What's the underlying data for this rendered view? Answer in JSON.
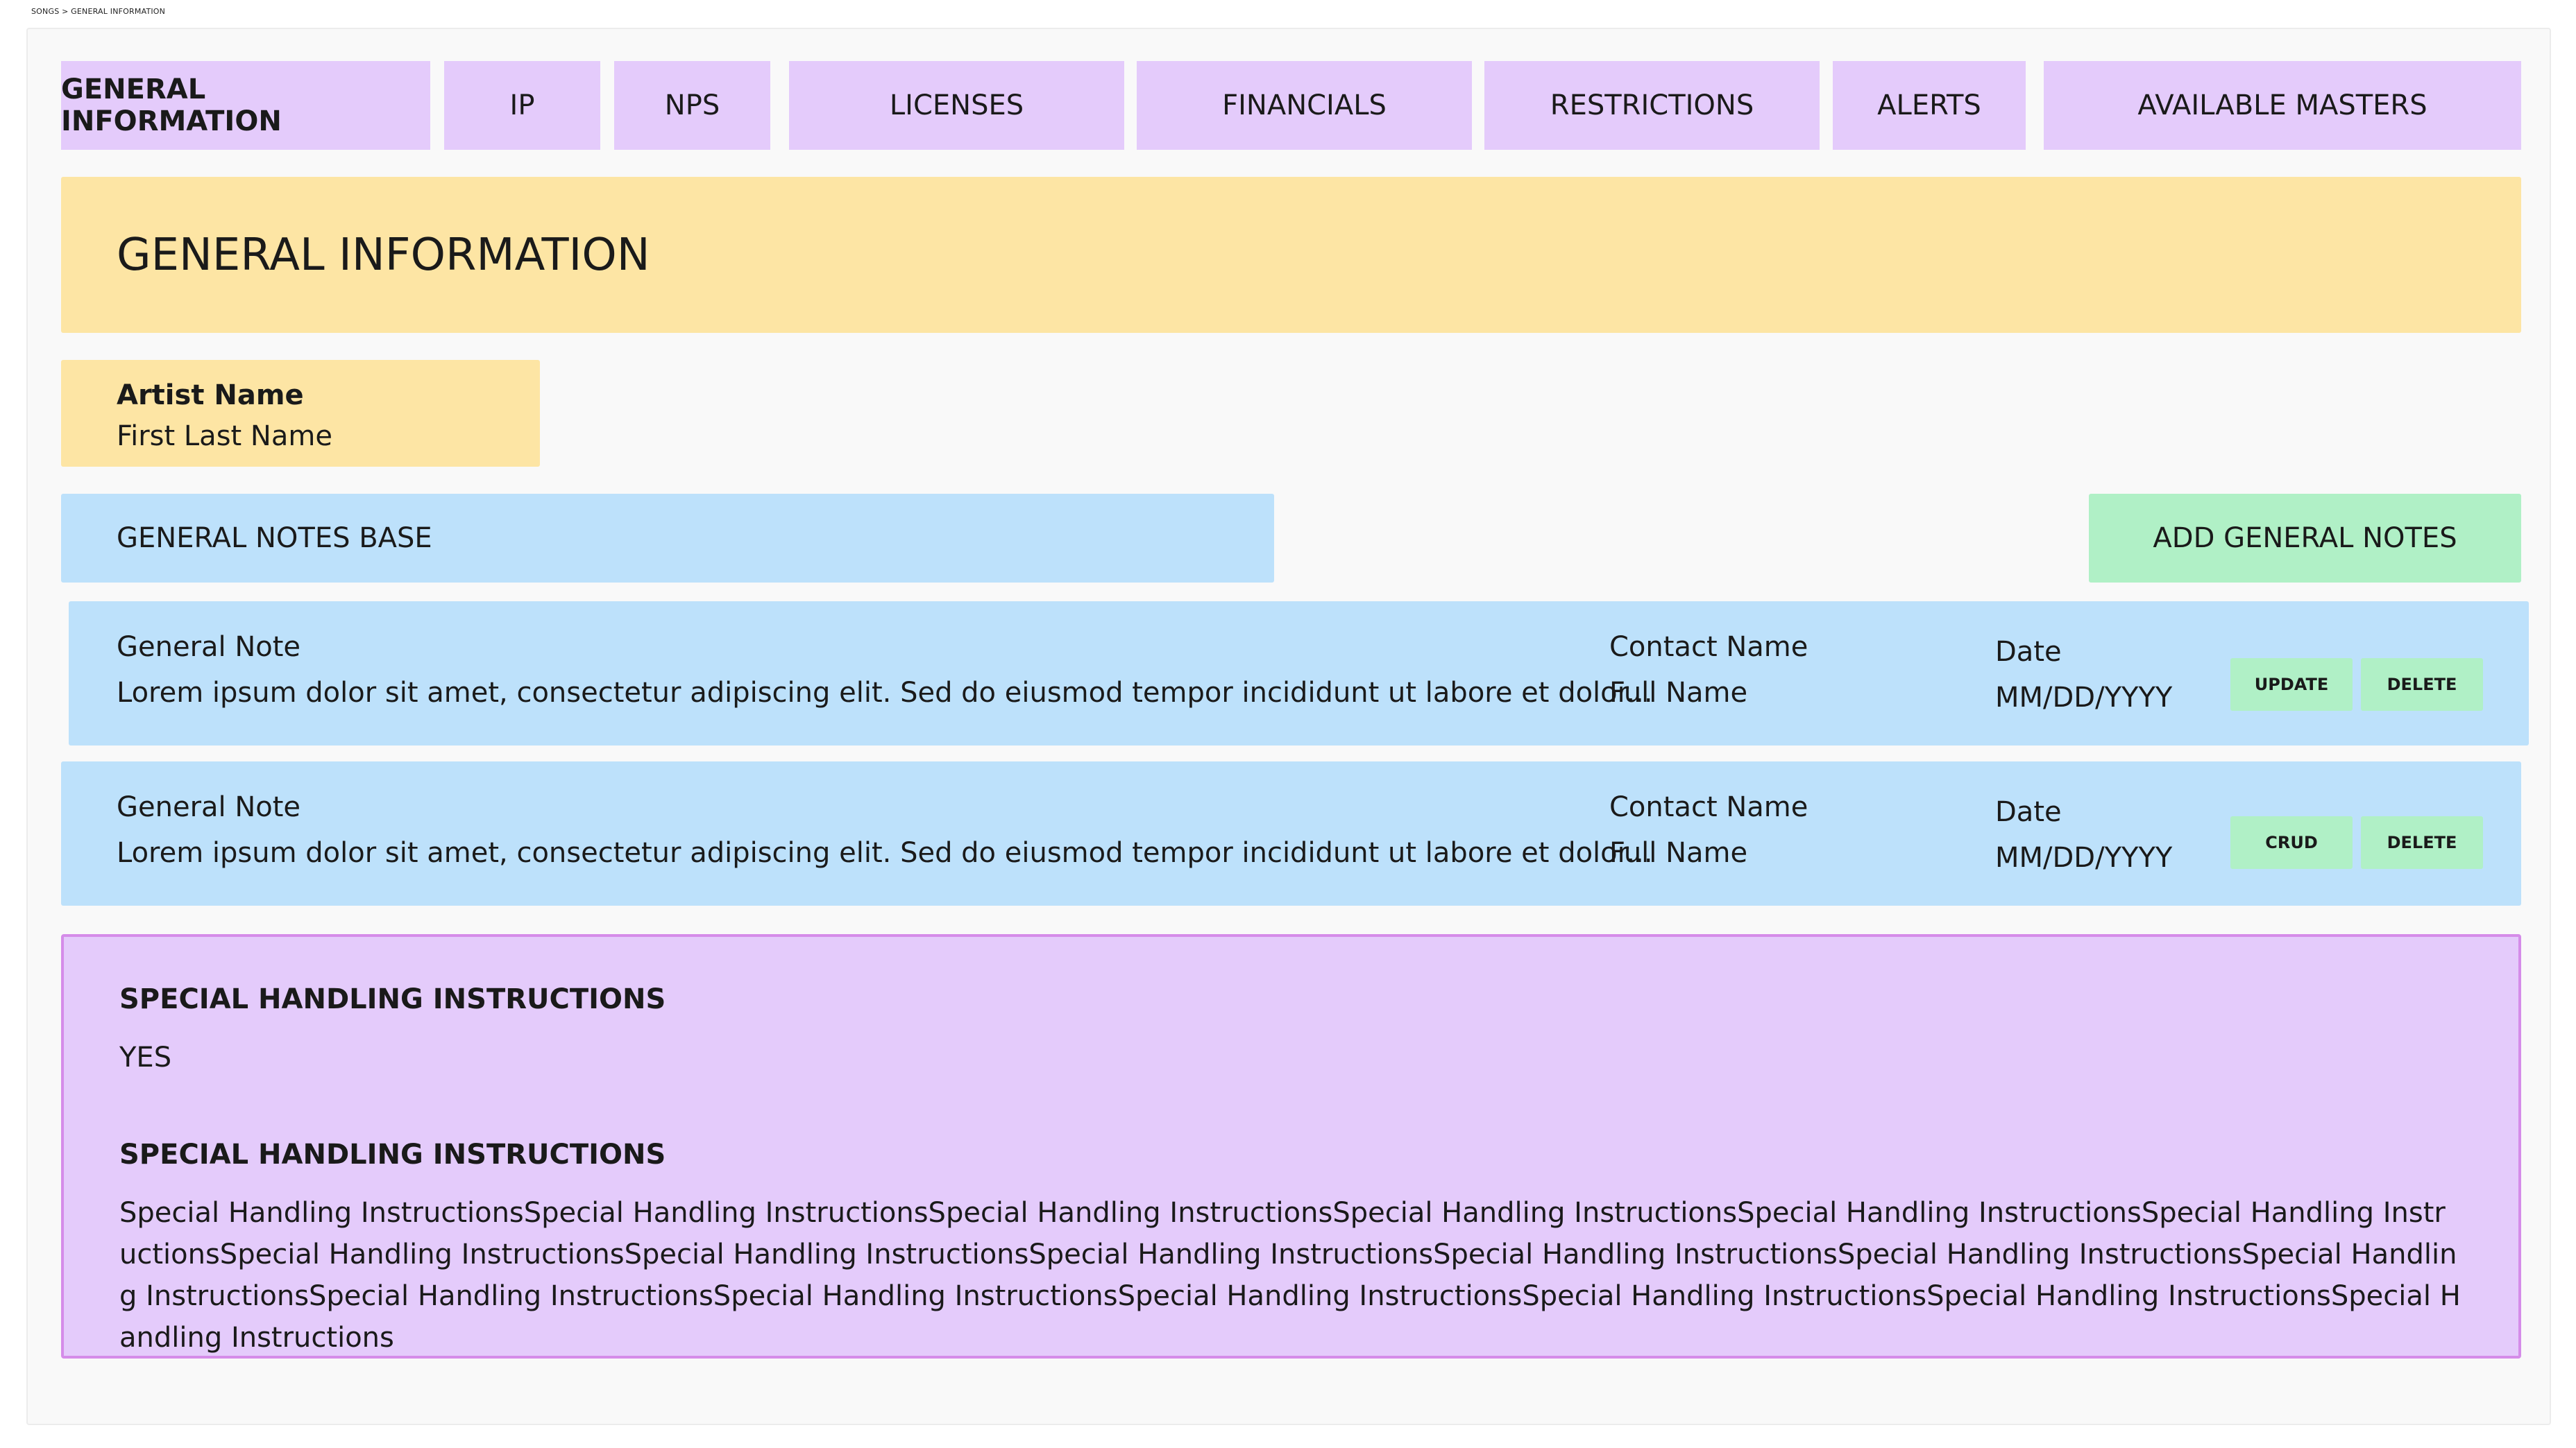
{
  "breadcrumb": "SONGS > GENERAL INFORMATION",
  "tabs": [
    {
      "label": "GENERAL INFORMATION"
    },
    {
      "label": "IP"
    },
    {
      "label": "NPS"
    },
    {
      "label": "LICENSES"
    },
    {
      "label": "FINANCIALS"
    },
    {
      "label": "RESTRICTIONS"
    },
    {
      "label": "ALERTS"
    },
    {
      "label": "AVAILABLE MASTERS"
    }
  ],
  "header": {
    "title": "GENERAL INFORMATION"
  },
  "artist": {
    "label": "Artist Name",
    "value": "First Last Name"
  },
  "notes": {
    "base_label": "GENERAL NOTES BASE",
    "add_label": "ADD GENERAL NOTES",
    "rows": [
      {
        "note_label": "General Note",
        "note_text": "Lorem ipsum dolor sit amet, consectetur adipiscing elit. Sed do eiusmod tempor incididunt ut labore et dolor...",
        "contact_label": "Contact Name",
        "contact_value": "Full Name",
        "date_label": "Date",
        "date_value": "MM/DD/YYYY",
        "btn1": "UPDATE",
        "btn2": "DELETE"
      },
      {
        "note_label": "General Note",
        "note_text": "Lorem ipsum dolor sit amet, consectetur adipiscing elit. Sed do eiusmod tempor incididunt ut labore et dolor...",
        "contact_label": "Contact Name",
        "contact_value": "Full Name",
        "date_label": "Date",
        "date_value": "MM/DD/YYYY",
        "btn1": "CRUD",
        "btn2": "DELETE"
      }
    ]
  },
  "special": {
    "heading1": "SPECIAL HANDLING INSTRUCTIONS",
    "value1": "YES",
    "heading2": "SPECIAL HANDLING INSTRUCTIONS",
    "body": "Special Handling InstructionsSpecial Handling InstructionsSpecial Handling InstructionsSpecial Handling InstructionsSpecial Handling InstructionsSpecial Handling InstructionsSpecial Handling InstructionsSpecial Handling InstructionsSpecial Handling InstructionsSpecial Handling InstructionsSpecial Handling InstructionsSpecial Handling InstructionsSpecial Handling InstructionsSpecial Handling InstructionsSpecial Handling InstructionsSpecial Handling InstructionsSpecial Handling InstructionsSpecial Handling Instructions"
  },
  "colors": {
    "tab_bg": "#e4cbfb",
    "banner_bg": "#fde5a4",
    "note_bg": "#bde1fb",
    "button_green": "#b0f0c6",
    "special_border": "#d58ce9"
  }
}
